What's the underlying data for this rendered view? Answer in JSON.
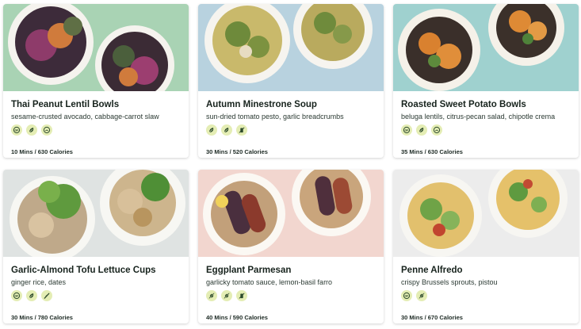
{
  "recipes": [
    {
      "title": "Thai Peanut Lentil Bowls",
      "subtitle": "sesame-crusted avocado, cabbage-carrot slaw",
      "icons": [
        "gluten-free-icon",
        "plant-based-icon",
        "dairy-free-icon"
      ],
      "meta": "10 Mins / 630 Calories",
      "background": "#a9d3b4"
    },
    {
      "title": "Autumn Minestrone Soup",
      "subtitle": "sun-dried tomato pesto, garlic breadcrumbs",
      "icons": [
        "plant-based-icon",
        "plant-based-icon",
        "no-dairy-icon"
      ],
      "meta": "30 Mins / 520 Calories",
      "background": "#b8d2df"
    },
    {
      "title": "Roasted Sweet Potato Bowls",
      "subtitle": "beluga lentils, citrus-pecan salad, chipotle crema",
      "icons": [
        "gluten-free-icon",
        "plant-based-icon",
        "dairy-free-icon"
      ],
      "meta": "35 Mins / 630 Calories",
      "background": "#9fd1cf"
    },
    {
      "title": "Garlic-Almond Tofu Lettuce Cups",
      "subtitle": "ginger rice, dates",
      "icons": [
        "gluten-free-icon",
        "plant-based-icon",
        "leaf-icon"
      ],
      "meta": "30 Mins / 780 Calories",
      "background": "#dfe3e2"
    },
    {
      "title": "Eggplant Parmesan",
      "subtitle": "garlicky tomato sauce, lemon-basil farro",
      "icons": [
        "no-meat-icon",
        "no-meat-icon",
        "no-dairy-icon"
      ],
      "meta": "40 Mins / 590 Calories",
      "background": "#f2d6cf"
    },
    {
      "title": "Penne Alfredo",
      "subtitle": "crispy Brussels sprouts, pistou",
      "icons": [
        "gluten-free-icon",
        "no-meat-icon"
      ],
      "meta": "30 Mins / 670 Calories",
      "background": "#ececec"
    }
  ],
  "colors": {
    "badge": "#e4edb4",
    "icon": "#2d4a2b"
  }
}
